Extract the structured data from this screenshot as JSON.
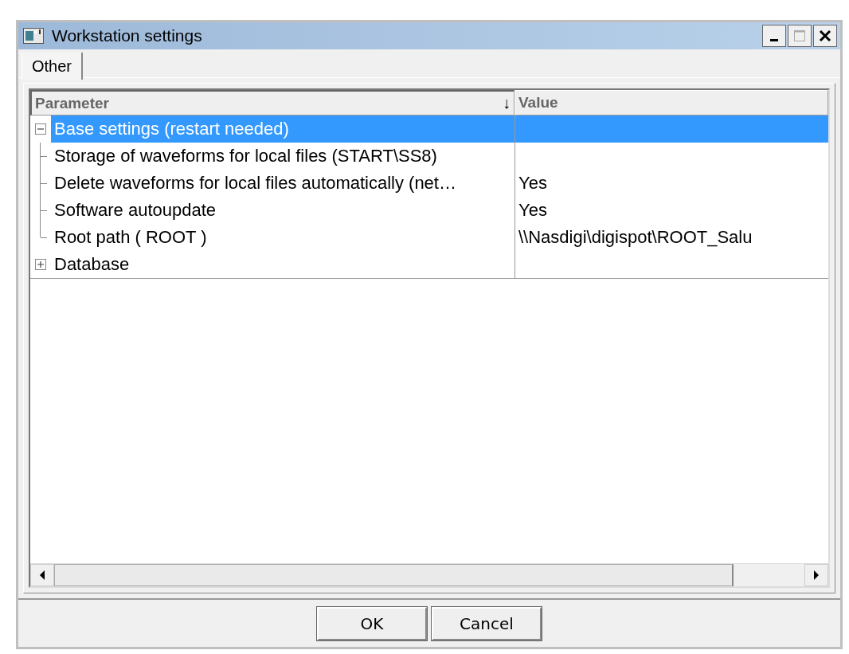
{
  "window": {
    "title": "Workstation settings"
  },
  "tabs": [
    {
      "label": "Other",
      "selected": true
    }
  ],
  "table": {
    "columns": [
      {
        "label": "Parameter",
        "sort_indicator": "↓"
      },
      {
        "label": "Value"
      }
    ],
    "rows": [
      {
        "label": "Base settings (restart needed)",
        "selected": true,
        "expanded": true,
        "children": [
          {
            "label": "Storage of waveforms for local files (START\\SS8)",
            "selected": false
          },
          {
            "label": "Delete waveforms for local files automatically (net…",
            "value": "Yes",
            "selected": false
          },
          {
            "label": "Software autoupdate",
            "value": "Yes",
            "selected": false
          },
          {
            "label": "Root path ( ROOT )",
            "value": "\\\\Nasdigi\\digispot\\ROOT_Salu",
            "selected": false
          }
        ]
      },
      {
        "label": "Database",
        "selected": false,
        "expanded": false
      }
    ]
  },
  "buttons": [
    {
      "label": "OK"
    },
    {
      "label": "Cancel"
    }
  ]
}
